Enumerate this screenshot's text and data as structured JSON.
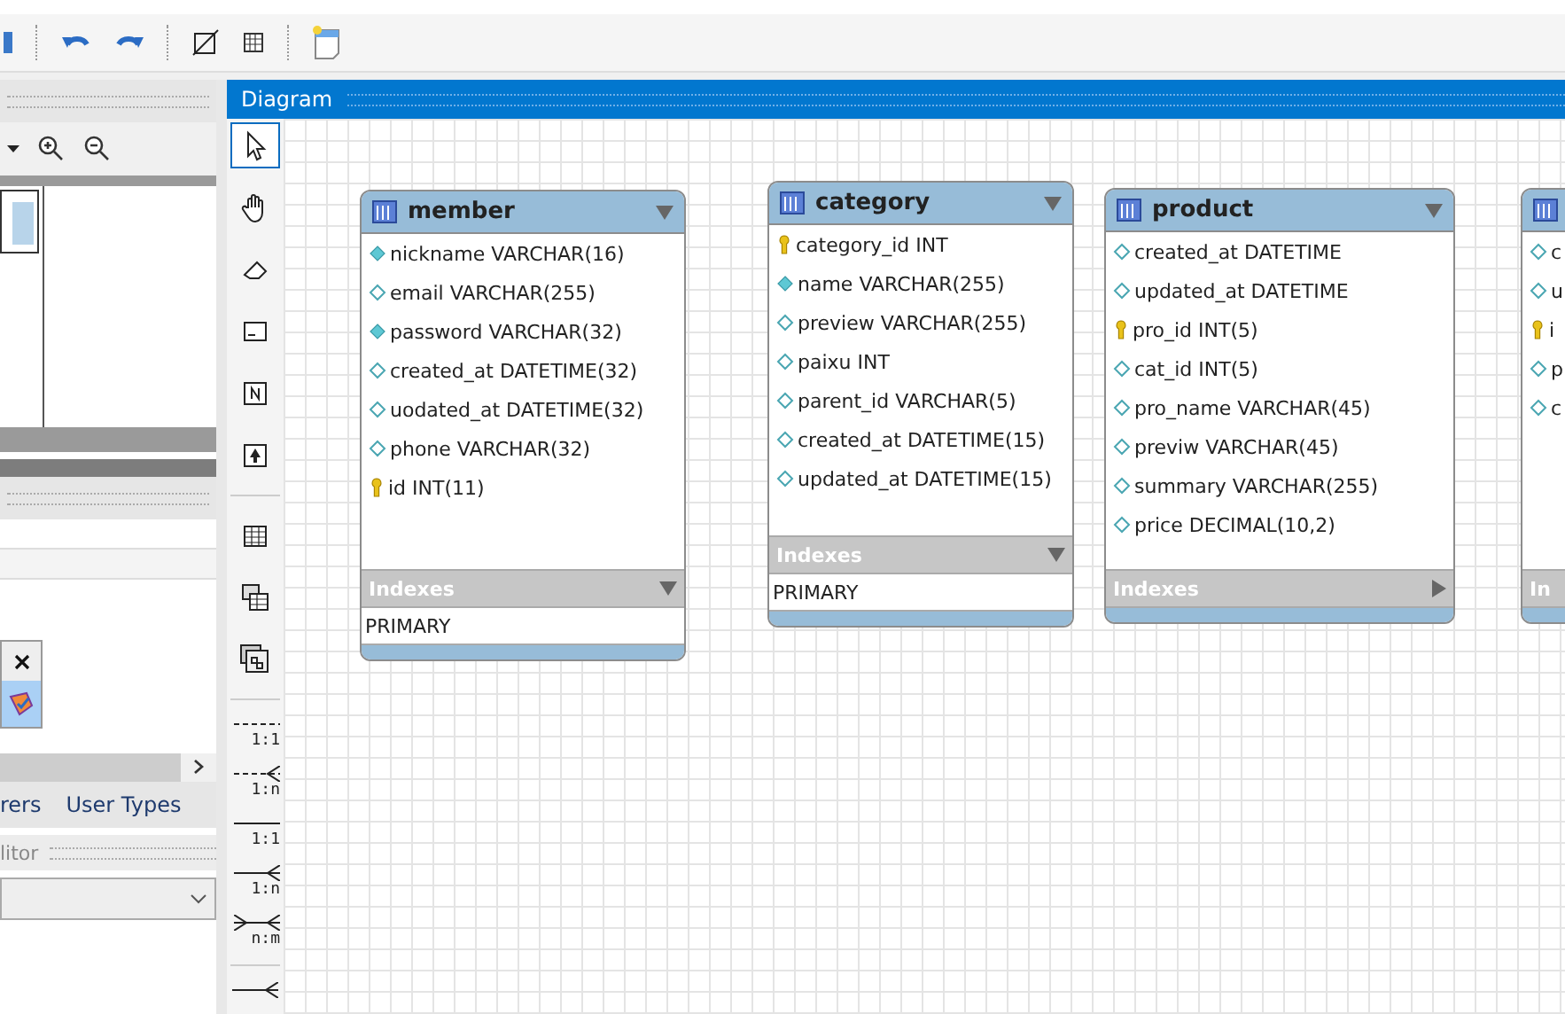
{
  "left_panel": {
    "tabs": [
      {
        "label": "rers",
        "selected": false
      },
      {
        "label": "User Types",
        "selected": false
      }
    ],
    "section_title": "litor"
  },
  "diagram": {
    "title": "Diagram",
    "tools": [
      {
        "kind": "pointer",
        "selected": true
      },
      {
        "kind": "hand",
        "selected": false
      },
      {
        "kind": "eraser",
        "selected": false
      },
      {
        "kind": "layer",
        "selected": false
      },
      {
        "kind": "note",
        "selected": false
      },
      {
        "kind": "image",
        "selected": false
      },
      {
        "kind": "table",
        "selected": false
      },
      {
        "kind": "view",
        "selected": false
      },
      {
        "kind": "routine",
        "selected": false
      }
    ],
    "relationships": [
      {
        "label": "1:1",
        "kind": "dashed"
      },
      {
        "label": "1:n",
        "kind": "dashed-many"
      },
      {
        "label": "1:1",
        "kind": "solid"
      },
      {
        "label": "1:n",
        "kind": "solid-many"
      },
      {
        "label": "n:m",
        "kind": "many-many"
      }
    ],
    "tables": [
      {
        "name": "member",
        "columns": [
          {
            "text": "nickname VARCHAR(16)",
            "kind": "not-null"
          },
          {
            "text": "email VARCHAR(255)",
            "kind": "column"
          },
          {
            "text": "password VARCHAR(32)",
            "kind": "not-null"
          },
          {
            "text": "created_at DATETIME(32)",
            "kind": "column"
          },
          {
            "text": "uodated_at DATETIME(32)",
            "kind": "column"
          },
          {
            "text": "phone VARCHAR(32)",
            "kind": "column"
          },
          {
            "text": "id INT(11)",
            "kind": "key"
          }
        ],
        "indexes_title": "Indexes",
        "indexes_expanded": true,
        "indexes": [
          "PRIMARY"
        ]
      },
      {
        "name": "category",
        "columns": [
          {
            "text": "category_id INT",
            "kind": "key"
          },
          {
            "text": "name VARCHAR(255)",
            "kind": "not-null"
          },
          {
            "text": "preview VARCHAR(255)",
            "kind": "column"
          },
          {
            "text": "paixu INT",
            "kind": "column"
          },
          {
            "text": "parent_id VARCHAR(5)",
            "kind": "column"
          },
          {
            "text": "created_at DATETIME(15)",
            "kind": "column"
          },
          {
            "text": "updated_at DATETIME(15)",
            "kind": "column"
          }
        ],
        "indexes_title": "Indexes",
        "indexes_expanded": true,
        "indexes": [
          "PRIMARY"
        ]
      },
      {
        "name": "product",
        "columns": [
          {
            "text": "created_at DATETIME",
            "kind": "column"
          },
          {
            "text": "updated_at DATETIME",
            "kind": "column"
          },
          {
            "text": "pro_id INT(5)",
            "kind": "key"
          },
          {
            "text": "cat_id INT(5)",
            "kind": "column"
          },
          {
            "text": "pro_name VARCHAR(45)",
            "kind": "column"
          },
          {
            "text": "previw VARCHAR(45)",
            "kind": "column"
          },
          {
            "text": "summary VARCHAR(255)",
            "kind": "column"
          },
          {
            "text": "price DECIMAL(10,2)",
            "kind": "column"
          }
        ],
        "indexes_title": "Indexes",
        "indexes_expanded": false
      },
      {
        "columns": [
          {
            "text": "c",
            "kind": "column"
          },
          {
            "text": "u",
            "kind": "column"
          },
          {
            "text": "i",
            "kind": "key"
          },
          {
            "text": "p",
            "kind": "column"
          },
          {
            "text": "c",
            "kind": "column"
          }
        ],
        "indexes_title": "In"
      }
    ]
  }
}
